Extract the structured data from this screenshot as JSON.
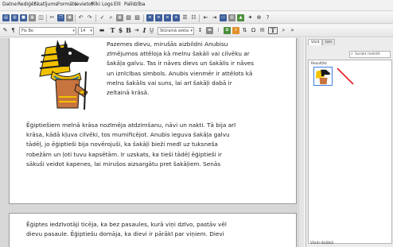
{
  "menu": [
    "Datne",
    "Rediģēt",
    "Skatījums",
    "Formāts",
    "Ievietot",
    "Rīki",
    "Logs",
    "Elli",
    "Palīdzība"
  ],
  "toolbar": {
    "font_name": "Fix Bo",
    "font_size": "14",
    "style_select": "Stūrainā sekta",
    "bold_label": "B",
    "italic_label": "I",
    "text_label": "T",
    "dollar_label": "$"
  },
  "document": {
    "para1_lines": [
      "Pazemes dievu, mirušās aizbildni Anubisu",
      "zīmējumos attēloja kā melnu šakāli vai cilvēku ar",
      "šakāļa galvu. Tas ir nāves dievs un šakālis ir nāves",
      "un iznīcības simbols. Anubis vienmēr ir attēlots kā",
      "melns šakālis vai suns, lai arī šakāļi dabā ir",
      "zeltainā krāsā."
    ],
    "para2_lines": [
      "Ēģiptiešiem melnā krāsa nozīmēja atdzimšanu, nāvi un nakti. Tā bija arī",
      "krāsa, kādā kļuva cilvēki, tos mumificējot. Anubis ieguva šakāļa galvu",
      "tādēļ, jo ēģiptieši bija novērojuši, ka šakāļi bieži medī uz tuksneša",
      "robežām un ļoti tuvu kapsētām. Ir uzskats, ka tieši tādēļ ēģiptieši ir",
      "sākuši veidot kapenes, lai mirušos aizsargātu pret šakāļiem. Senās"
    ],
    "para3_lines": [
      "Ēģiptes iedzīvotāji ticēja, ka bez pasaules, kurā viņi dzīvo, pastāv vēl",
      "dievu pasaule. Ēģiptiešu domāja, ka dievi ir pārākī par viņiem. Dievi"
    ]
  },
  "side_panel": {
    "tabs": [
      "Vārd",
      "Izm"
    ],
    "search_label": "Sarakt meklēt",
    "results_label": "Rezultāti",
    "bottom_label": "Vārdi dziļākā"
  },
  "colors": {
    "anubis_black": "#1a1a1a",
    "gold": "#f2c200",
    "skin": "#c8743e",
    "selection": "#3d7de0",
    "no_symbol": "#e02020"
  }
}
